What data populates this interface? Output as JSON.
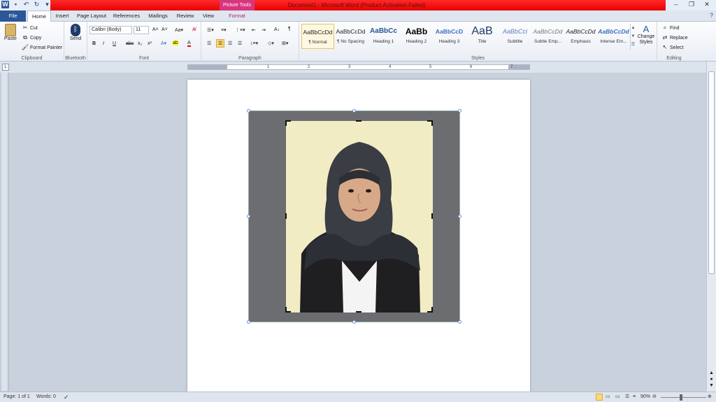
{
  "window": {
    "title": "Document1 - Microsoft Word (Product Activation Failed)",
    "contextual_tab_group": "Picture Tools"
  },
  "tabs": [
    {
      "label": "File"
    },
    {
      "label": "Home"
    },
    {
      "label": "Insert"
    },
    {
      "label": "Page Layout"
    },
    {
      "label": "References"
    },
    {
      "label": "Mailings"
    },
    {
      "label": "Review"
    },
    {
      "label": "View"
    },
    {
      "label": "Format"
    }
  ],
  "clipboard": {
    "paste": "Paste",
    "cut": "Cut",
    "copy": "Copy",
    "format_painter": "Format Painter",
    "label": "Clipboard"
  },
  "bluetooth": {
    "send": "Send",
    "label": "Bluetooth"
  },
  "font": {
    "name": "Calibri (Body)",
    "size": "11",
    "label": "Font",
    "bold": "B",
    "italic": "I",
    "underline": "U",
    "strike": "abc",
    "sub": "x₂",
    "sup": "x²"
  },
  "paragraph": {
    "label": "Paragraph",
    "pilcrow": "¶"
  },
  "styles": {
    "label": "Styles",
    "items": [
      {
        "sample": "AaBbCcDd",
        "name": "¶ Normal"
      },
      {
        "sample": "AaBbCcDd",
        "name": "¶ No Spacing"
      },
      {
        "sample": "AaBbCc",
        "name": "Heading 1"
      },
      {
        "sample": "AaBb",
        "name": "Heading 2"
      },
      {
        "sample": "AaBbCcD",
        "name": "Heading 3"
      },
      {
        "sample": "AaB",
        "name": "Title"
      },
      {
        "sample": "AaBbCci",
        "name": "Subtitle"
      },
      {
        "sample": "AaBbCcDd",
        "name": "Subtle Emp..."
      },
      {
        "sample": "AaBbCcDd",
        "name": "Emphasis"
      },
      {
        "sample": "AaBbCcDd",
        "name": "Intense Em..."
      }
    ],
    "change_styles": "Change Styles"
  },
  "editing": {
    "label": "Editing",
    "find": "Find",
    "replace": "Replace",
    "select": "Select"
  },
  "ruler": {
    "ticks": [
      "1",
      "2",
      "3",
      "4",
      "5",
      "6",
      "7"
    ]
  },
  "status": {
    "page": "Page: 1 of 1",
    "words": "Words: 0",
    "zoom": "90%"
  },
  "colors": {
    "title_bar_alert": "#e80000",
    "file_tab": "#2b579a",
    "picture_tools": "#d8357f",
    "crop_area": "#6b6d70",
    "photo_background": "#f1ecc4"
  }
}
